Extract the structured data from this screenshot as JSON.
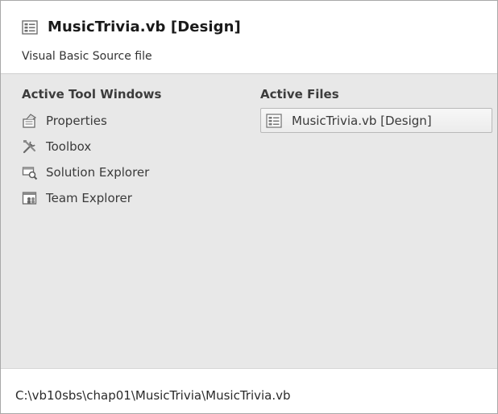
{
  "header": {
    "title": "MusicTrivia.vb [Design]",
    "subtitle": "Visual Basic Source file",
    "icon": "designer-form-icon"
  },
  "tool_windows": {
    "heading": "Active Tool Windows",
    "items": [
      {
        "label": "Properties",
        "icon": "properties-icon"
      },
      {
        "label": "Toolbox",
        "icon": "toolbox-icon"
      },
      {
        "label": "Solution Explorer",
        "icon": "solution-explorer-icon"
      },
      {
        "label": "Team Explorer",
        "icon": "team-explorer-icon"
      }
    ]
  },
  "active_files": {
    "heading": "Active Files",
    "items": [
      {
        "label": "MusicTrivia.vb [Design]",
        "icon": "designer-form-icon"
      }
    ]
  },
  "footer": {
    "path": "C:\\vb10sbs\\chap01\\MusicTrivia\\MusicTrivia.vb"
  },
  "colors": {
    "panel_bg": "#e8e8e8",
    "header_bg": "#ffffff",
    "border": "#a8a8a8"
  }
}
